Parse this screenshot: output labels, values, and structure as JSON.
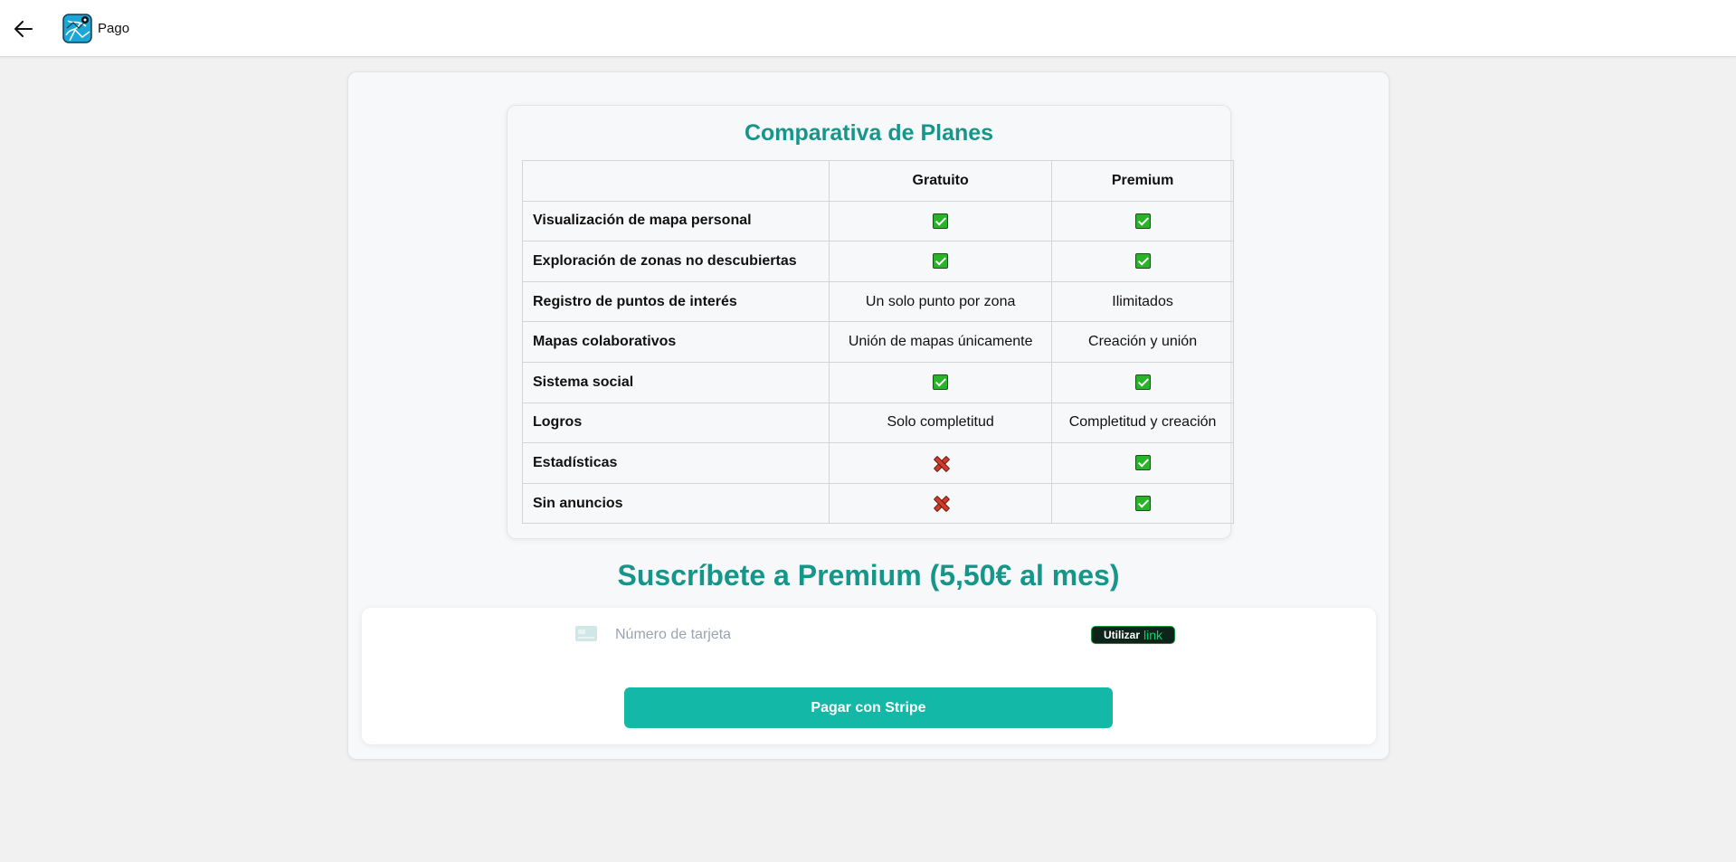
{
  "header": {
    "title": "Pago",
    "back_icon": "arrow-left-icon",
    "logo_icon": "app-map-logo-icon"
  },
  "comparison": {
    "title": "Comparativa de Planes",
    "columns": [
      "",
      "Gratuito",
      "Premium"
    ],
    "rows": [
      {
        "feature": "Visualización de mapa personal",
        "free": "check",
        "premium": "check"
      },
      {
        "feature": "Exploración de zonas no descubiertas",
        "free": "check",
        "premium": "check"
      },
      {
        "feature": "Registro de puntos de interés",
        "free": "Un solo punto por zona",
        "premium": "Ilimitados"
      },
      {
        "feature": "Mapas colaborativos",
        "free": "Unión de mapas únicamente",
        "premium": "Creación y unión"
      },
      {
        "feature": "Sistema social",
        "free": "check",
        "premium": "check"
      },
      {
        "feature": "Logros",
        "free": "Solo completitud",
        "premium": "Completitud y creación"
      },
      {
        "feature": "Estadísticas",
        "free": "cross",
        "premium": "check"
      },
      {
        "feature": "Sin anuncios",
        "free": "cross",
        "premium": "check"
      }
    ]
  },
  "subscribe": {
    "title": "Suscríbete a Premium (5,50€ al mes)"
  },
  "payment": {
    "card_icon": "credit-card-icon",
    "card_placeholder": "Número de tarjeta",
    "link_label": "Utilizar",
    "link_brand": "link",
    "pay_button": "Pagar con Stripe"
  },
  "colors": {
    "accent": "#16968a",
    "button": "#14b8a6",
    "check": "#27b427",
    "cross": "#d13b2a",
    "link_bg": "#0e2319",
    "link_brand": "#00d66f"
  }
}
